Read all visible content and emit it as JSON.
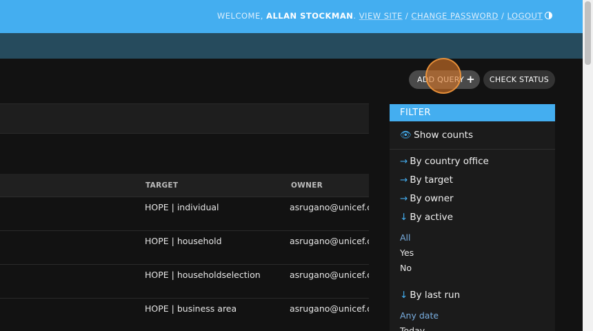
{
  "header": {
    "welcome": "WELCOME,",
    "user_name": "ALLAN STOCKMAN",
    "period": ".",
    "view_site": "VIEW SITE",
    "sep": "/",
    "change_password": "CHANGE PASSWORD",
    "logout": "LOGOUT"
  },
  "toolbar": {
    "add_query": "ADD QUERY",
    "add_icon": "+",
    "check_status": "CHECK STATUS"
  },
  "table": {
    "columns": [
      "TARGET",
      "OWNER"
    ],
    "rows": [
      {
        "target": "HOPE | individual",
        "owner": "asrugano@unicef.org"
      },
      {
        "target": "HOPE | household",
        "owner": "asrugano@unicef.org"
      },
      {
        "target": "HOPE | householdselection",
        "owner": "asrugano@unicef.org"
      },
      {
        "target": "HOPE | business area",
        "owner": "asrugano@unicef.org"
      }
    ]
  },
  "filter": {
    "title": "FILTER",
    "show_counts": "Show counts",
    "by_country_office": "By country office",
    "by_target": "By target",
    "by_owner": "By owner",
    "by_active": "By active",
    "active_options": [
      "All",
      "Yes",
      "No"
    ],
    "by_last_run": "By last run",
    "last_run_options": [
      "Any date",
      "Today"
    ],
    "arrow_right": "→",
    "arrow_down": "↓",
    "eye_glyph": "👁"
  },
  "colors": {
    "header": "#44aef0",
    "breadcrumbs": "#264b5d",
    "background": "#121212",
    "accent": "#44aef0"
  }
}
